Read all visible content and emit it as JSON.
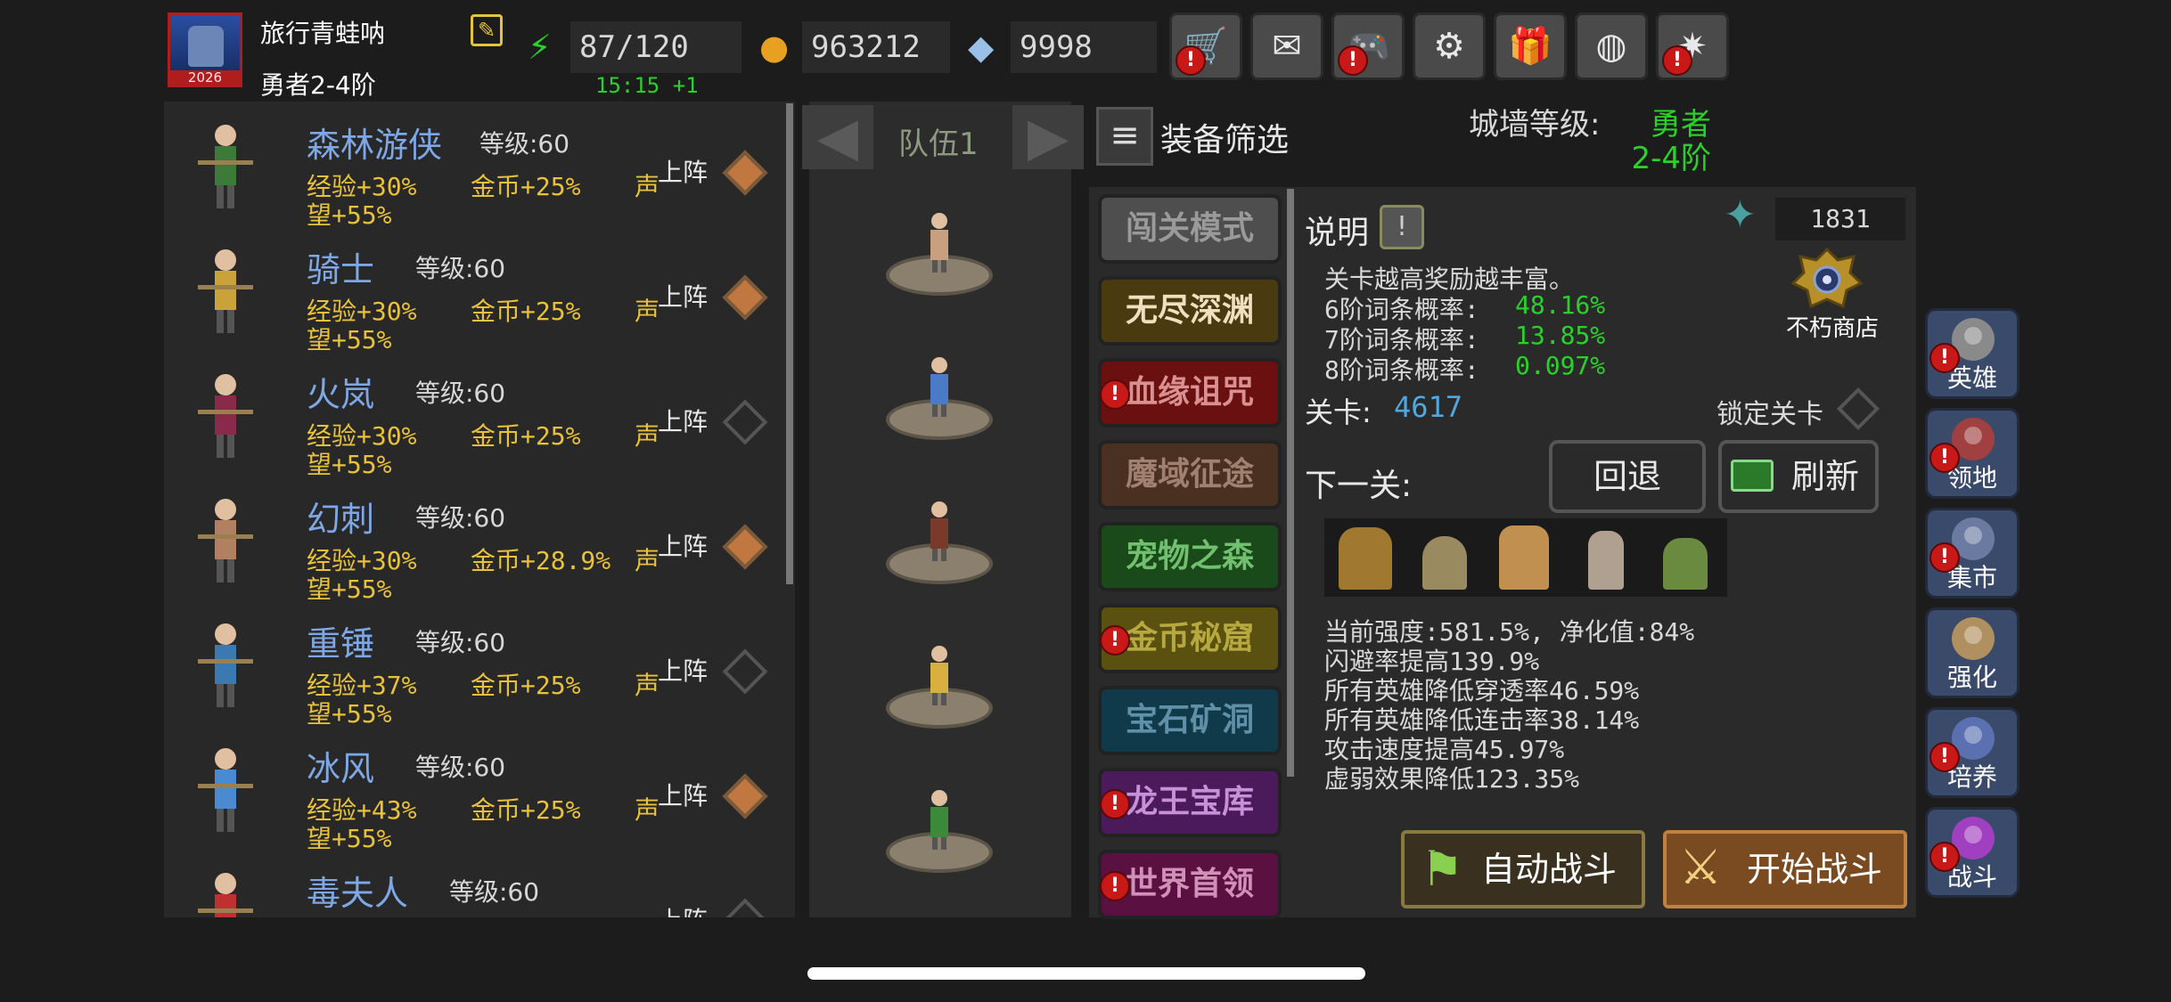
{
  "player": {
    "name": "旅行青蛙呐",
    "rank": "勇者2-4阶",
    "avatar_badge": "2026"
  },
  "resources": {
    "energy": "87/120",
    "energy_timer": "15:15 +1",
    "gold": "963212",
    "gems": "9998"
  },
  "toolbar": [
    {
      "name": "cart-icon",
      "glyph": "🛒",
      "alert": true
    },
    {
      "name": "mail-icon",
      "glyph": "✉",
      "alert": false
    },
    {
      "name": "controller-icon",
      "glyph": "🎮",
      "alert": true
    },
    {
      "name": "gear-icon",
      "glyph": "⚙",
      "alert": false
    },
    {
      "name": "gift-icon",
      "glyph": "🎁",
      "alert": false
    },
    {
      "name": "lottery-wheel-icon",
      "glyph": "◍",
      "alert": false
    },
    {
      "name": "firework-icon",
      "glyph": "✷",
      "alert": true
    }
  ],
  "heroes": [
    {
      "name": "森林游侠",
      "level": "等级:60",
      "exp": "经验+30%",
      "gold": "金币+25%",
      "fame_a": "声",
      "fame_b": "望+55%",
      "deploy": "上阵",
      "selected": true,
      "color": "#3d7a3a"
    },
    {
      "name": "骑士",
      "level": "等级:60",
      "exp": "经验+30%",
      "gold": "金币+25%",
      "fame_a": "声",
      "fame_b": "望+55%",
      "deploy": "上阵",
      "selected": true,
      "color": "#c9a23a"
    },
    {
      "name": "火岚",
      "level": "等级:60",
      "exp": "经验+30%",
      "gold": "金币+25%",
      "fame_a": "声",
      "fame_b": "望+55%",
      "deploy": "上阵",
      "selected": false,
      "color": "#8a2a4a"
    },
    {
      "name": "幻刺",
      "level": "等级:60",
      "exp": "经验+30%",
      "gold": "金币+28.9%",
      "fame_a": "声",
      "fame_b": "望+55%",
      "deploy": "上阵",
      "selected": true,
      "color": "#b08060"
    },
    {
      "name": "重锤",
      "level": "等级:60",
      "exp": "经验+37%",
      "gold": "金币+25%",
      "fame_a": "声",
      "fame_b": "望+55%",
      "deploy": "上阵",
      "selected": false,
      "color": "#3a7ab0"
    },
    {
      "name": "冰风",
      "level": "等级:60",
      "exp": "经验+43%",
      "gold": "金币+25%",
      "fame_a": "声",
      "fame_b": "望+55%",
      "deploy": "上阵",
      "selected": true,
      "color": "#4a8ad0"
    },
    {
      "name": "毒夫人",
      "level": "等级:60",
      "exp": "",
      "gold": "",
      "fame_a": "",
      "fame_b": "",
      "deploy": "上阵",
      "selected": false,
      "color": "#c03030"
    }
  ],
  "team": {
    "label": "队伍1",
    "members": [
      "#c8a080",
      "#4a7ac8",
      "#7a3a2a",
      "#d8b040",
      "#3a8a3a"
    ]
  },
  "filter": {
    "label": "装备筛选"
  },
  "wall": {
    "label": "城墙等级:",
    "value_a": "勇者",
    "value_b": "2-4阶"
  },
  "modes": [
    {
      "label": "闯关模式",
      "bg": "#4e4e4e",
      "fg": "#9a9a9a",
      "alert": false
    },
    {
      "label": "无尽深渊",
      "bg": "#4a3a10",
      "fg": "#f0e0c0",
      "alert": false
    },
    {
      "label": "血缘诅咒",
      "bg": "#6a1010",
      "fg": "#d89090",
      "alert": true
    },
    {
      "label": "魔域征途",
      "bg": "#4a3020",
      "fg": "#a08070",
      "alert": false
    },
    {
      "label": "宠物之森",
      "bg": "#1a4a1a",
      "fg": "#70c070",
      "alert": false
    },
    {
      "label": "金币秘窟",
      "bg": "#5a5010",
      "fg": "#b8a840",
      "alert": true
    },
    {
      "label": "宝石矿洞",
      "bg": "#103a4a",
      "fg": "#6090a8",
      "alert": false
    },
    {
      "label": "龙王宝库",
      "bg": "#4a1a5a",
      "fg": "#c890d8",
      "alert": true
    },
    {
      "label": "世界首领",
      "bg": "#5a1040",
      "fg": "#d090b8",
      "alert": true
    }
  ],
  "info": {
    "title": "说明",
    "gem_count": "1831",
    "shop_label": "不朽商店",
    "desc": "关卡越高奖励越丰富。",
    "odds": [
      {
        "label": "6阶词条概率:",
        "value": "48.16%"
      },
      {
        "label": "7阶词条概率:",
        "value": "13.85%"
      },
      {
        "label": "8阶词条概率:",
        "value": "0.097%"
      }
    ],
    "stage_label": "关卡:",
    "stage_value": "4617",
    "lock_label": "锁定关卡",
    "next_label": "下一关:",
    "back_label": "回退",
    "refresh_label": "刷新"
  },
  "effects": [
    "当前强度:581.5%, 净化值:84%",
    "闪避率提高139.9%",
    "所有英雄降低穿透率46.59%",
    "所有英雄降低连击率38.14%",
    "攻击速度提高45.97%",
    "虚弱效果降低123.35%"
  ],
  "battle": {
    "auto_label": "自动战斗",
    "start_label": "开始战斗"
  },
  "side_nav": [
    {
      "label": "英雄",
      "name": "helmet-icon",
      "alert": true
    },
    {
      "label": "领地",
      "name": "castle-icon",
      "alert": true
    },
    {
      "label": "集市",
      "name": "shop-icon",
      "alert": true
    },
    {
      "label": "强化",
      "name": "crystal-icon",
      "alert": false
    },
    {
      "label": "培养",
      "name": "chalice-icon",
      "alert": true
    },
    {
      "label": "战斗",
      "name": "portal-icon",
      "alert": true
    }
  ]
}
